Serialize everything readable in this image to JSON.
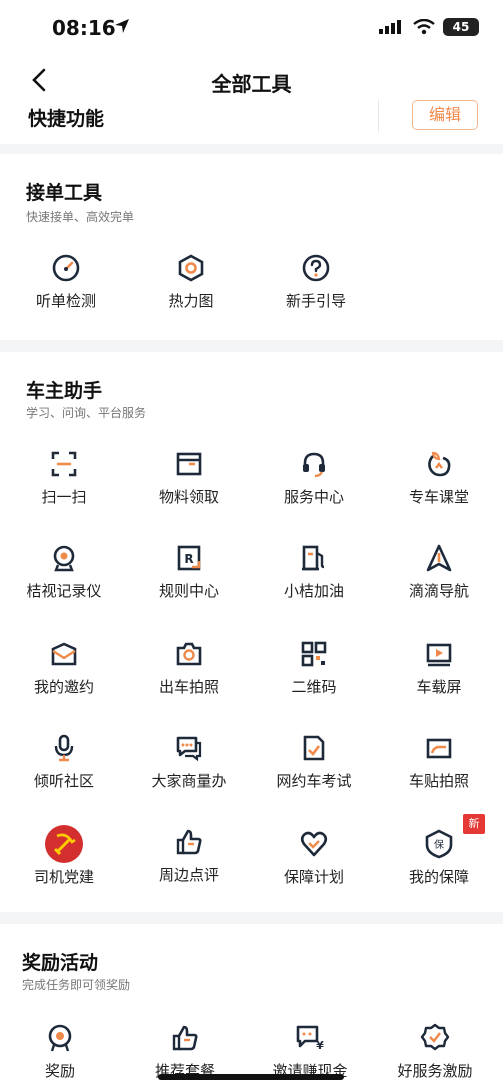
{
  "status": {
    "time": "08:16",
    "battery": "45"
  },
  "header": {
    "title": "全部工具"
  },
  "quick": {
    "title": "快捷功能",
    "edit_label": "编辑"
  },
  "order_tools": {
    "title": "接单工具",
    "subtitle": "快速接单、高效完单",
    "items": [
      {
        "label": "听单检测",
        "icon": "gauge-icon"
      },
      {
        "label": "热力图",
        "icon": "hexagon-icon"
      },
      {
        "label": "新手引导",
        "icon": "help-icon"
      }
    ]
  },
  "owner_assist": {
    "title": "车主助手",
    "subtitle": "学习、问询、平台服务",
    "items": [
      {
        "label": "扫一扫",
        "icon": "scan-icon"
      },
      {
        "label": "物料领取",
        "icon": "material-icon"
      },
      {
        "label": "服务中心",
        "icon": "headset-icon"
      },
      {
        "label": "专车课堂",
        "icon": "classroom-icon"
      },
      {
        "label": "桔视记录仪",
        "icon": "camera-recorder-icon"
      },
      {
        "label": "规则中心",
        "icon": "rules-icon"
      },
      {
        "label": "小桔加油",
        "icon": "fuel-icon"
      },
      {
        "label": "滴滴导航",
        "icon": "navigation-icon"
      },
      {
        "label": "我的邀约",
        "icon": "mail-icon"
      },
      {
        "label": "出车拍照",
        "icon": "photo-camera-icon"
      },
      {
        "label": "二维码",
        "icon": "qrcode-icon"
      },
      {
        "label": "车载屏",
        "icon": "screen-play-icon"
      },
      {
        "label": "倾听社区",
        "icon": "microphone-icon"
      },
      {
        "label": "大家商量办",
        "icon": "chat-icon"
      },
      {
        "label": "网约车考试",
        "icon": "exam-icon"
      },
      {
        "label": "车贴拍照",
        "icon": "sticker-photo-icon"
      },
      {
        "label": "司机党建",
        "icon": "party-emblem-icon"
      },
      {
        "label": "周边点评",
        "icon": "thumbs-up-icon"
      },
      {
        "label": "保障计划",
        "icon": "heart-check-icon"
      },
      {
        "label": "我的保障",
        "icon": "shield-bao-icon",
        "badge": "新"
      }
    ]
  },
  "rewards": {
    "title": "奖励活动",
    "subtitle": "完成任务即可领奖励",
    "items": [
      {
        "label": "奖励",
        "icon": "medal-icon"
      },
      {
        "label": "推荐套餐",
        "icon": "thumbs-up-icon"
      },
      {
        "label": "邀请赚现金",
        "icon": "chat-yuan-icon"
      },
      {
        "label": "好服务激励",
        "icon": "badge-check-icon"
      }
    ]
  },
  "colors": {
    "accent": "#f08a4b",
    "icon_dark": "#1e2a3a",
    "badge_red": "#e53935",
    "gap": "#f4f5f7"
  }
}
